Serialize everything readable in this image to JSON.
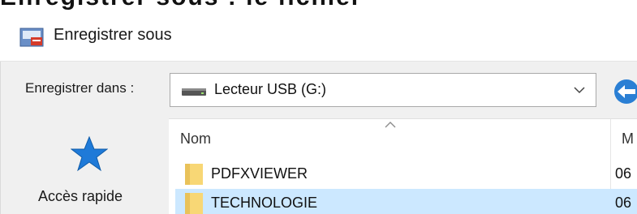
{
  "window": {
    "title": "Enregistrer sous",
    "cropped_top_text": "Enregistrer sous : le fichier"
  },
  "location": {
    "label": "Enregistrer dans :",
    "selected": "Lecteur USB (G:)"
  },
  "navigation": {
    "quick_access_label": "Accès rapide"
  },
  "file_list": {
    "columns": {
      "name": "Nom",
      "date": "M"
    },
    "rows": [
      {
        "name": "PDFXVIEWER",
        "date": "06",
        "selected": false
      },
      {
        "name": "TECHNOLOGIE",
        "date": "06",
        "selected": true
      }
    ]
  },
  "icons": {
    "app": "pdf-app-icon",
    "drive": "usb-drive-icon",
    "back": "back-arrow-icon",
    "star": "star-icon",
    "folder": "folder-icon"
  },
  "colors": {
    "selection": "#cce8ff",
    "accent": "#2a7fd4",
    "folder": "#f8d775"
  }
}
